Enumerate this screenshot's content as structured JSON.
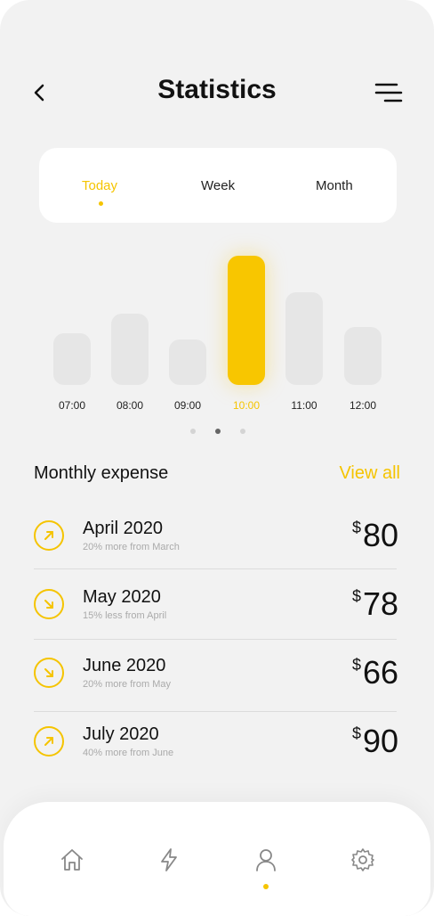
{
  "header": {
    "title": "Statistics"
  },
  "tabs": [
    {
      "label": "Today",
      "active": true
    },
    {
      "label": "Week",
      "active": false
    },
    {
      "label": "Month",
      "active": false
    }
  ],
  "chart_data": {
    "type": "bar",
    "categories": [
      "07:00",
      "08:00",
      "09:00",
      "10:00",
      "11:00",
      "12:00"
    ],
    "values": [
      40,
      55,
      35,
      100,
      72,
      45
    ],
    "active_index": 3,
    "colors": {
      "bar": "#e6e6e6",
      "active": "#f8c600"
    }
  },
  "pager": {
    "count": 3,
    "active_index": 1
  },
  "expenses": {
    "title": "Monthly expense",
    "view_all": "View all",
    "items": [
      {
        "title": "April 2020",
        "subtitle": "20% more from March",
        "currency": "$",
        "amount": "80",
        "direction": "up"
      },
      {
        "title": "May 2020",
        "subtitle": "15% less from April",
        "currency": "$",
        "amount": "78",
        "direction": "down"
      },
      {
        "title": "June 2020",
        "subtitle": "20% more from May",
        "currency": "$",
        "amount": "66",
        "direction": "down"
      },
      {
        "title": "July 2020",
        "subtitle": "40% more from June",
        "currency": "$",
        "amount": "90",
        "direction": "up"
      }
    ]
  },
  "navbar": {
    "items": [
      "home-icon",
      "lightning-icon",
      "user-icon",
      "gear-icon"
    ],
    "active_index": 2
  },
  "colors": {
    "accent": "#f5c400",
    "background": "#f2f2f2"
  }
}
